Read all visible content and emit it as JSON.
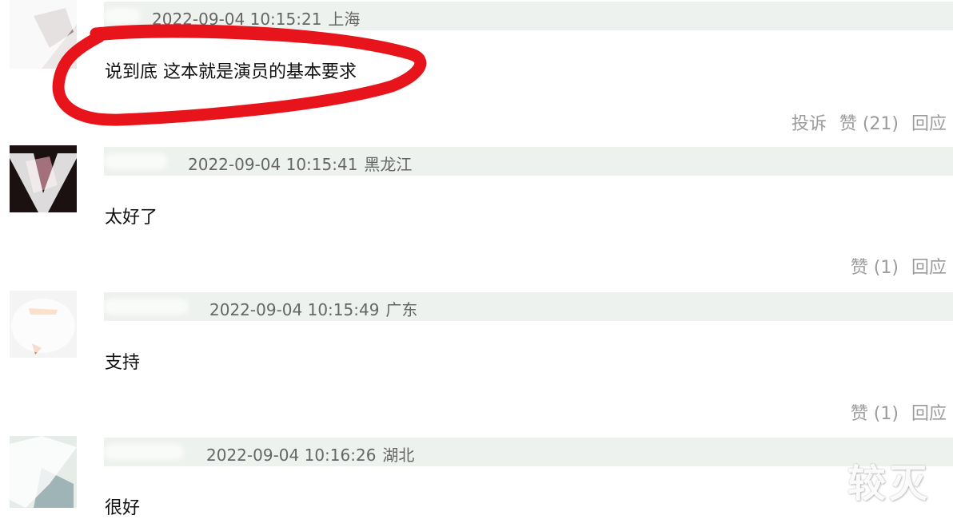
{
  "comments": [
    {
      "timestamp": "2022-09-04 10:15:21",
      "location": "上海",
      "text": "说到底 这本就是演员的基本要求",
      "actions": {
        "report": "投诉",
        "like": "赞 (21)",
        "reply": "回应"
      }
    },
    {
      "timestamp": "2022-09-04 10:15:41",
      "location": "黑龙江",
      "text": "太好了",
      "actions": {
        "like": "赞 (1)",
        "reply": "回应"
      }
    },
    {
      "timestamp": "2022-09-04 10:15:49",
      "location": "广东",
      "text": "支持",
      "actions": {
        "like": "赞 (1)",
        "reply": "回应"
      }
    },
    {
      "timestamp": "2022-09-04 10:16:26",
      "location": "湖北",
      "text": "很好",
      "actions": {}
    }
  ],
  "annotation": {
    "color": "#e8141c"
  },
  "watermark": "较灭",
  "colors": {
    "meta_bar": "#eef2ee",
    "action_text": "#9b9b9b",
    "meta_text": "#666666"
  }
}
